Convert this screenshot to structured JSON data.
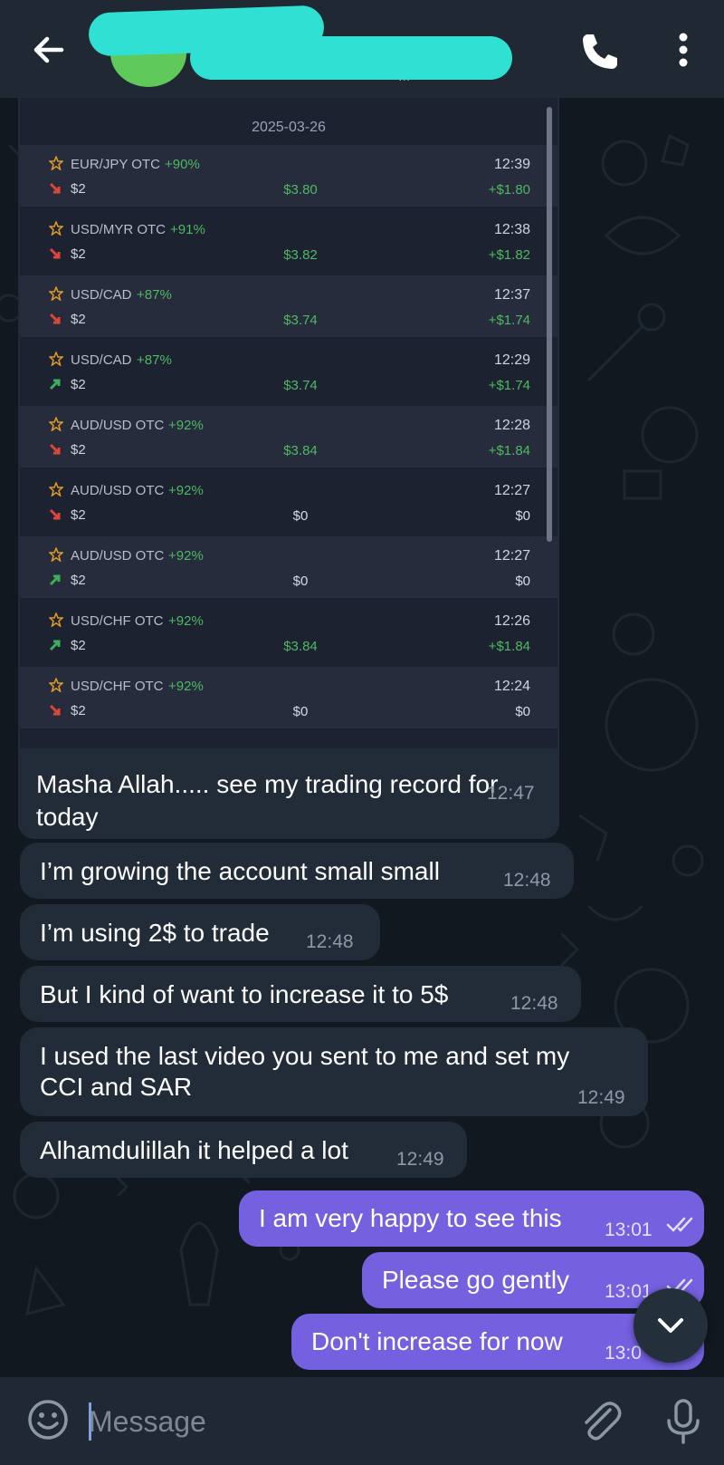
{
  "header": {
    "back_icon": "arrow-left-icon",
    "contact_name": "",
    "status_tail": "...",
    "call_icon": "phone-icon",
    "menu_icon": "more-vertical-icon"
  },
  "shared_screenshot": {
    "date": "2025-03-26",
    "trades": [
      {
        "pair": "EUR/JPY OTC",
        "pct": "+90%",
        "direction": "down",
        "amount": "$2",
        "payout": "$3.80",
        "time": "12:39",
        "profit": "+$1.80"
      },
      {
        "pair": "USD/MYR OTC",
        "pct": "+91%",
        "direction": "down",
        "amount": "$2",
        "payout": "$3.82",
        "time": "12:38",
        "profit": "+$1.82"
      },
      {
        "pair": "USD/CAD",
        "pct": "+87%",
        "direction": "down",
        "amount": "$2",
        "payout": "$3.74",
        "time": "12:37",
        "profit": "+$1.74"
      },
      {
        "pair": "USD/CAD",
        "pct": "+87%",
        "direction": "up",
        "amount": "$2",
        "payout": "$3.74",
        "time": "12:29",
        "profit": "+$1.74"
      },
      {
        "pair": "AUD/USD OTC",
        "pct": "+92%",
        "direction": "down",
        "amount": "$2",
        "payout": "$3.84",
        "time": "12:28",
        "profit": "+$1.84"
      },
      {
        "pair": "AUD/USD OTC",
        "pct": "+92%",
        "direction": "down",
        "amount": "$2",
        "payout": "$0",
        "time": "12:27",
        "profit": "$0"
      },
      {
        "pair": "AUD/USD OTC",
        "pct": "+92%",
        "direction": "up",
        "amount": "$2",
        "payout": "$0",
        "time": "12:27",
        "profit": "$0"
      },
      {
        "pair": "USD/CHF OTC",
        "pct": "+92%",
        "direction": "up",
        "amount": "$2",
        "payout": "$3.84",
        "time": "12:26",
        "profit": "+$1.84"
      },
      {
        "pair": "USD/CHF OTC",
        "pct": "+92%",
        "direction": "down",
        "amount": "$2",
        "payout": "$0",
        "time": "12:24",
        "profit": "$0"
      }
    ],
    "caption_line1": "Masha Allah..... see my trading record for",
    "caption_line2": "today",
    "caption_time": "12:47"
  },
  "messages_in": [
    {
      "text": "I’m growing the account small small",
      "time": "12:48"
    },
    {
      "text": "I’m using 2$ to trade",
      "time": "12:48"
    },
    {
      "text": "But I kind of want to increase it to 5$",
      "time": "12:48"
    },
    {
      "text_line1": "I used the last video you sent to me and set my",
      "text_line2": "CCI and SAR",
      "time": "12:49"
    },
    {
      "text": "Alhamdulillah it helped a lot",
      "time": "12:49"
    }
  ],
  "messages_out": [
    {
      "text": "I am very happy to see this",
      "time": "13:01"
    },
    {
      "text": "Please go gently",
      "time": "13:01"
    },
    {
      "text": "Don't increase for now",
      "time": "13:0"
    }
  ],
  "input": {
    "placeholder": "Message",
    "emoji_icon": "smiley-icon",
    "attach_icon": "paperclip-icon",
    "mic_icon": "microphone-icon",
    "scroll_down_icon": "chevron-down-icon"
  },
  "colors": {
    "background": "#111820",
    "bar": "#1f2833",
    "bubble_in": "#222c39",
    "bubble_out": "#7560e0",
    "profit_green": "#4fb862",
    "down_arrow": "#e0453a",
    "up_arrow": "#3fae5a"
  }
}
